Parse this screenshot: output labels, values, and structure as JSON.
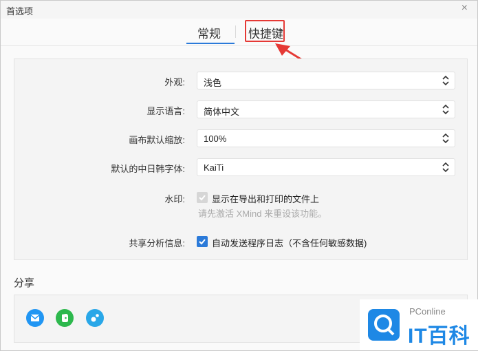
{
  "window": {
    "title": "首选项"
  },
  "tabs": [
    {
      "label": "常规",
      "active": true
    },
    {
      "label": "快捷键",
      "active": false
    }
  ],
  "settings": {
    "appearance": {
      "label": "外观:",
      "value": "浅色"
    },
    "language": {
      "label": "显示语言:",
      "value": "简体中文"
    },
    "zoom": {
      "label": "画布默认缩放:",
      "value": "100%"
    },
    "cjk_font": {
      "label": "默认的中日韩字体:",
      "value": "KaiTi"
    },
    "watermark": {
      "label": "水印:",
      "checkbox_label": "显示在导出和打印的文件上",
      "checked": true,
      "disabled": true,
      "hint": "请先激活 XMind 来重设该功能。"
    },
    "analytics": {
      "label": "共享分析信息:",
      "checkbox_label": "自动发送程序日志（不含任何敏感数据)",
      "checked": true
    }
  },
  "share": {
    "title": "分享",
    "icons": [
      "mail-icon",
      "evernote-icon",
      "share-link-icon"
    ]
  },
  "watermark_logo": {
    "sub": "PConline",
    "main": "IT百科"
  },
  "colors": {
    "accent": "#2b7ad9",
    "highlight": "#e53935",
    "logo": "#1e88e5"
  }
}
